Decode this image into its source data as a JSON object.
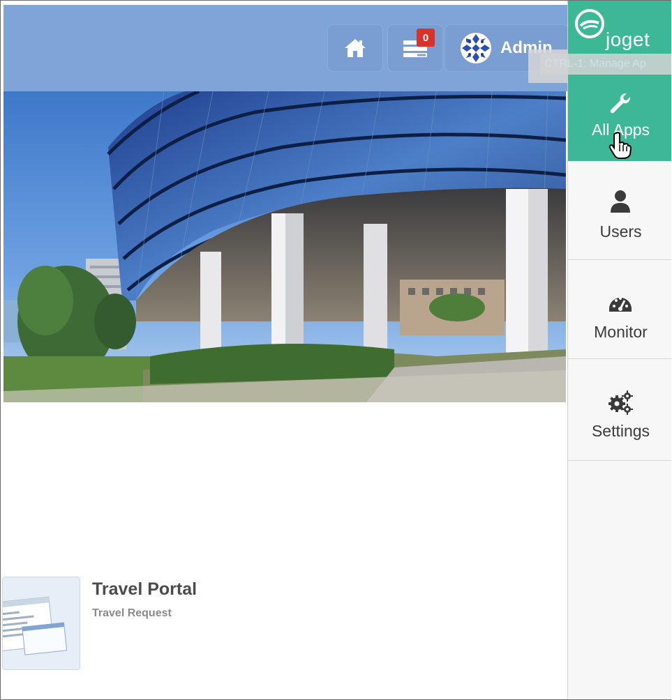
{
  "header": {
    "home_icon": "home-icon",
    "inbox_icon": "inbox-list-icon",
    "inbox_count": "0",
    "user_name": "Admin",
    "tooltip_fragment": "CTRL-1: Manage Ap"
  },
  "sidebar": {
    "brand": "joget",
    "items": [
      {
        "label": "All Apps",
        "icon": "wrench-icon",
        "active": true
      },
      {
        "label": "Users",
        "icon": "user-icon",
        "active": false
      },
      {
        "label": "Monitor",
        "icon": "dashboard-gauge-icon",
        "active": false
      },
      {
        "label": "Settings",
        "icon": "cogs-icon",
        "active": false
      }
    ]
  },
  "apps": [
    {
      "title": "Travel Portal",
      "subtitle": "Travel Request"
    }
  ],
  "colors": {
    "header_bg": "#7fa4d8",
    "brand_green": "#3cb897",
    "badge_red": "#d9322b"
  }
}
